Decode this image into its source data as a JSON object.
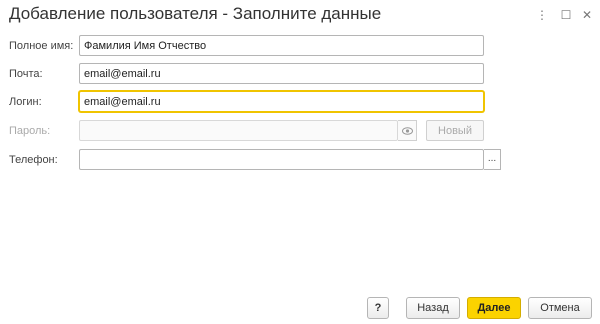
{
  "window": {
    "title": "Добавление пользователя - Заполните данные",
    "controls": {
      "more": "⋮",
      "maximize": "☐",
      "close": "✕"
    }
  },
  "form": {
    "full_name": {
      "label": "Полное имя:",
      "value": "Фамилия Имя Отчество"
    },
    "email": {
      "label": "Почта:",
      "value": "email@email.ru"
    },
    "login": {
      "label": "Логин:",
      "value": "email@email.ru"
    },
    "password": {
      "label": "Пароль:",
      "value": "",
      "new_button": "Новый"
    },
    "phone": {
      "label": "Телефон:",
      "value": "",
      "select_button": "..."
    }
  },
  "footer": {
    "help": "?",
    "back": "Назад",
    "next": "Далее",
    "cancel": "Отмена"
  },
  "colors": {
    "accent": "#fbd300",
    "focus_border": "#f0c400"
  }
}
